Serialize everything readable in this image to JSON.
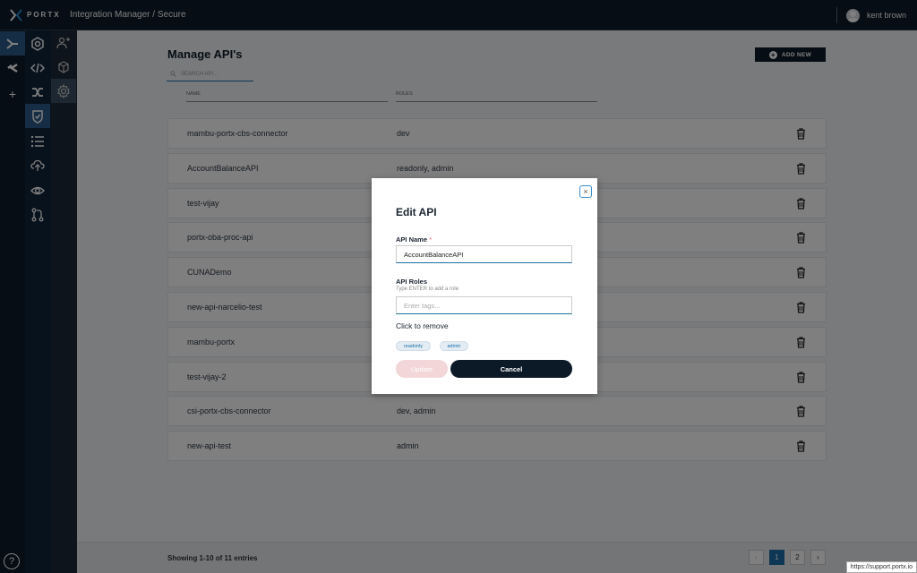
{
  "header": {
    "logo_text": "PORTX",
    "breadcrumb": "Integration Manager / Secure",
    "user_name": "kent brown"
  },
  "page": {
    "title": "Manage API's",
    "add_new_label": "ADD NEW",
    "search_placeholder": "SEARCH API...",
    "columns": [
      "NAME",
      "ROLES"
    ]
  },
  "rows": [
    {
      "name": "mambu-portx-cbs-connector",
      "roles": "dev"
    },
    {
      "name": "AccountBalanceAPI",
      "roles": "readonly, admin"
    },
    {
      "name": "test-vijay",
      "roles": ""
    },
    {
      "name": "portx-oba-proc-api",
      "roles": ""
    },
    {
      "name": "CUNADemo",
      "roles": ""
    },
    {
      "name": "new-api-narcelio-test",
      "roles": ""
    },
    {
      "name": "mambu-portx",
      "roles": ""
    },
    {
      "name": "test-vijay-2",
      "roles": ""
    },
    {
      "name": "csi-portx-cbs-connector",
      "roles": "dev, admin"
    },
    {
      "name": "new-api-test",
      "roles": "admin"
    }
  ],
  "footer": {
    "showing": "Showing 1-10 of 11 entries",
    "pages": [
      "‹",
      "1",
      "2",
      "›"
    ]
  },
  "status_url": "https://support.portx.io",
  "modal": {
    "title": "Edit API",
    "close_label": "×",
    "api_name_label": "API Name",
    "required_mark": "*",
    "api_name_value": "AccountBalanceAPI",
    "api_roles_label": "API Roles",
    "api_roles_hint": "Type ENTER to add a role",
    "tags_placeholder": "Enter tags...",
    "click_remove": "Click to remove",
    "tags": [
      "readonly",
      "admin"
    ],
    "update_label": "Update",
    "cancel_label": "Cancel"
  },
  "icons": {
    "help": "?",
    "add": "+"
  },
  "colors": {
    "nav_dark": "#0c1a28",
    "accent": "#1b6ea8",
    "update_disabled": "#f2d6d8"
  }
}
